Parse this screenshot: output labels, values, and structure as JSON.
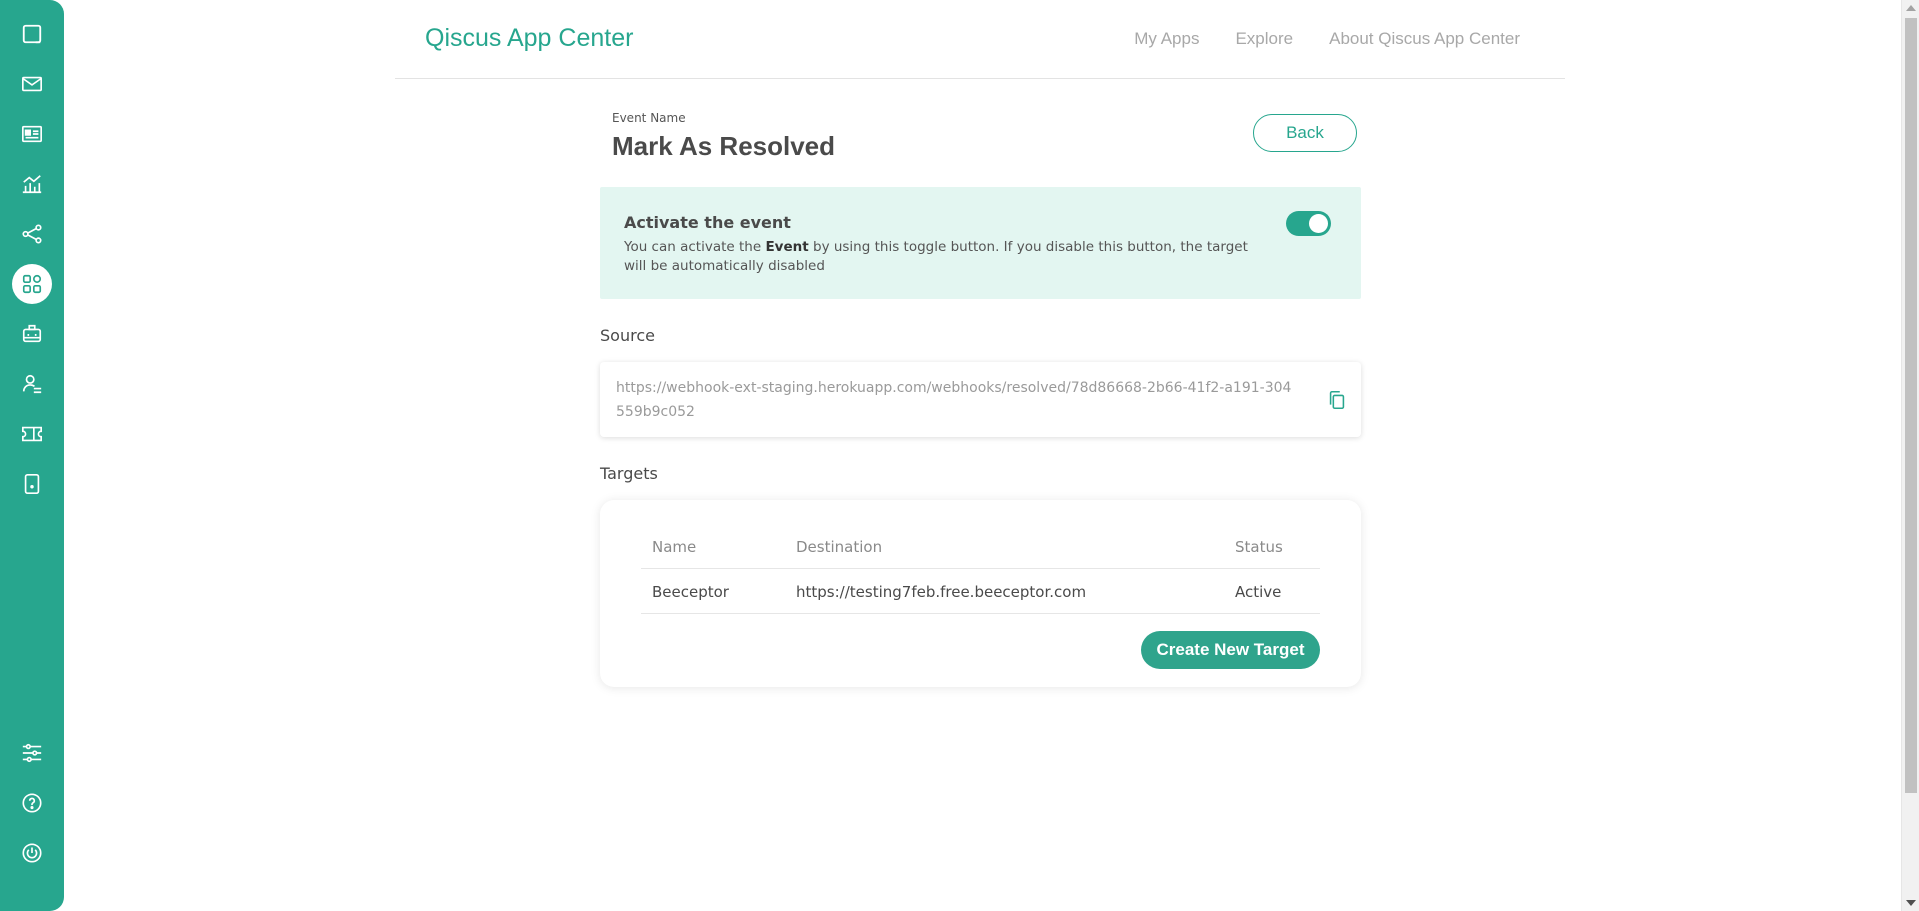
{
  "header": {
    "app_title": "Qiscus App Center",
    "nav": [
      {
        "label": "My Apps"
      },
      {
        "label": "Explore"
      },
      {
        "label": "About Qiscus App Center"
      }
    ]
  },
  "sidebar": {
    "items": [
      {
        "icon": "chat-icon"
      },
      {
        "icon": "mail-icon"
      },
      {
        "icon": "contact-card-icon"
      },
      {
        "icon": "analytics-icon"
      },
      {
        "icon": "integration-icon"
      },
      {
        "icon": "app-center-icon",
        "active": true
      },
      {
        "icon": "bot-icon"
      },
      {
        "icon": "agent-icon"
      },
      {
        "icon": "ticket-icon"
      },
      {
        "icon": "mobile-icon"
      }
    ],
    "bottom_items": [
      {
        "icon": "settings-sliders-icon"
      },
      {
        "icon": "help-icon"
      },
      {
        "icon": "power-icon"
      }
    ]
  },
  "event": {
    "label": "Event Name",
    "name": "Mark As Resolved",
    "back_label": "Back"
  },
  "activate": {
    "title": "Activate the event",
    "desc_prefix": "You can activate the ",
    "desc_bold": "Event",
    "desc_suffix": " by using this toggle button. If you disable this button, the target will be automatically disabled",
    "enabled": true
  },
  "source": {
    "label": "Source",
    "url": "https://webhook-ext-staging.herokuapp.com/webhooks/resolved/78d86668-2b66-41f2-a191-304559b9c052"
  },
  "targets": {
    "label": "Targets",
    "columns": [
      "Name",
      "Destination",
      "Status"
    ],
    "rows": [
      {
        "name": "Beeceptor",
        "destination": "https://testing7feb.free.beeceptor.com",
        "status": "Active"
      }
    ],
    "create_label": "Create New Target"
  },
  "colors": {
    "brand": "#27a68e",
    "activate_bg": "#e3f6f1"
  }
}
